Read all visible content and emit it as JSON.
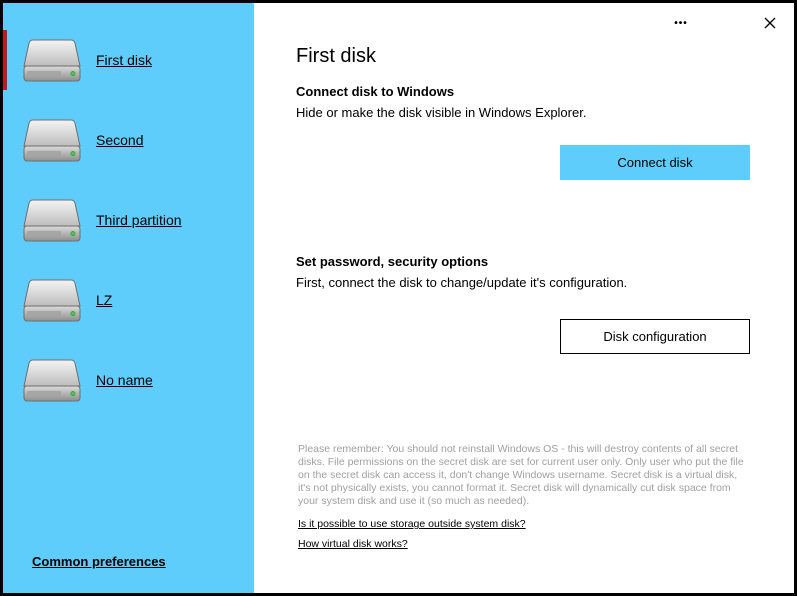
{
  "sidebar": {
    "disks": [
      {
        "label": "First disk",
        "active": true
      },
      {
        "label": "Second",
        "active": false
      },
      {
        "label": "Third partition",
        "active": false
      },
      {
        "label": "LZ",
        "active": false
      },
      {
        "label": "No name",
        "active": false
      }
    ],
    "common_preferences": "Common preferences",
    "colors": {
      "background": "#5fcdfb",
      "active_indicator": "#c8161d"
    }
  },
  "titlebar": {
    "more_icon": "more-icon",
    "more_glyph": "•••",
    "close_icon": "close-icon"
  },
  "main": {
    "title": "First disk",
    "connect_section": {
      "heading": "Connect disk to Windows",
      "description": "Hide or make the disk visible in Windows Explorer.",
      "button_label": "Connect disk"
    },
    "security_section": {
      "heading": "Set password, security options",
      "description": "First, connect the disk to change/update it's configuration.",
      "button_label": "Disk configuration"
    },
    "notice": "Please remember: You should not reinstall Windows OS - this will destroy contents of all secret disks. File permissions on the secret disk are set for current user only. Only user who put the file on the secret disk can access it, don't change Windows username. Secret disk is a virtual disk, it's not physically exists, you cannot format it. Secret disk will dynamically cut disk space from your system disk and use it (so much as needed).",
    "links": {
      "storage_outside": "Is it possible to use storage outside system disk?",
      "how_virtual": "How virtual disk works?"
    }
  }
}
